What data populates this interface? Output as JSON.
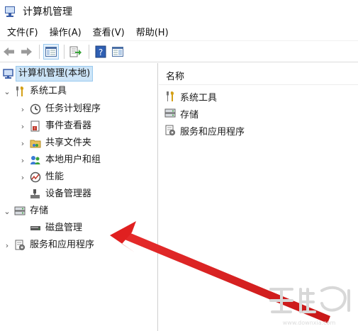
{
  "window": {
    "title": "计算机管理"
  },
  "menu": [
    "文件(F)",
    "操作(A)",
    "查看(V)",
    "帮助(H)"
  ],
  "toolbar": {
    "buttons": [
      "back-icon",
      "forward-icon",
      "show-hide-tree-icon",
      "export-list-icon",
      "help-icon",
      "properties-icon"
    ]
  },
  "tree": {
    "root": "计算机管理(本地)",
    "system_tools": "系统工具",
    "task_scheduler": "任务计划程序",
    "event_viewer": "事件查看器",
    "shared_folders": "共享文件夹",
    "local_users": "本地用户和组",
    "performance": "性能",
    "device_manager": "设备管理器",
    "storage": "存储",
    "disk_management": "磁盘管理",
    "services": "服务和应用程序"
  },
  "list": {
    "header": "名称",
    "items": [
      "系统工具",
      "存储",
      "服务和应用程序"
    ]
  },
  "colors": {
    "arrow": "#e02020",
    "selection": "#cce4f7"
  }
}
